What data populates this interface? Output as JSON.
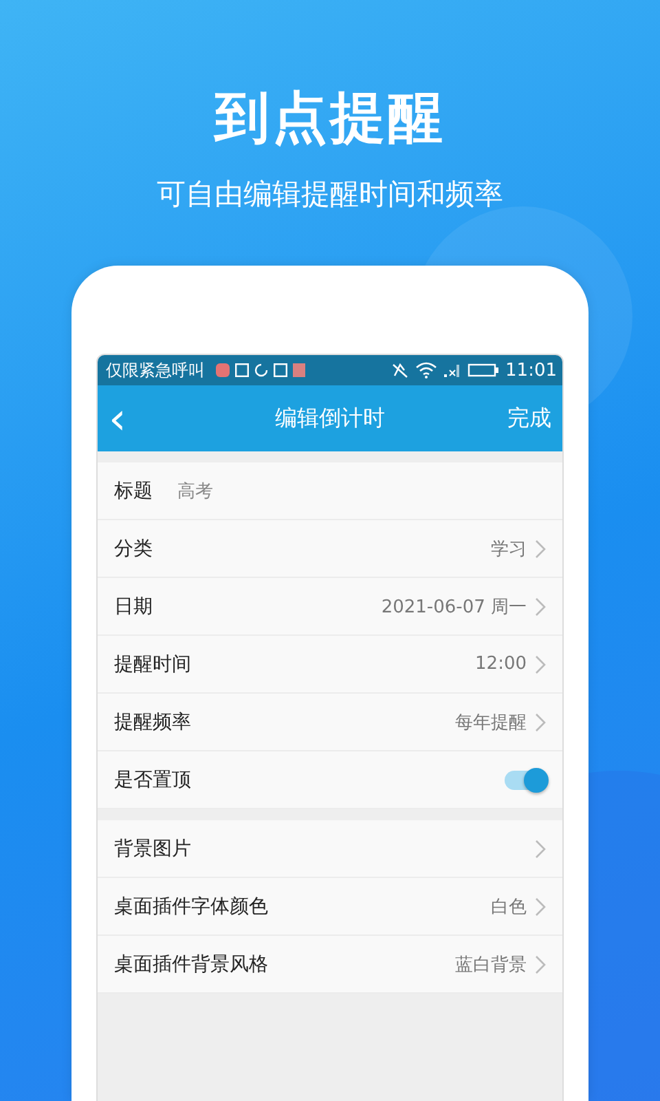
{
  "headline": "到点提醒",
  "subtitle": "可自由编辑提醒时间和频率",
  "status_bar": {
    "carrier": "仅限紧急呼叫",
    "time": "11:01"
  },
  "app_bar": {
    "back": "‹",
    "title": "编辑倒计时",
    "action": "完成"
  },
  "sections": [
    {
      "rows": [
        {
          "kind": "input",
          "label": "标题",
          "value": "高考"
        },
        {
          "kind": "select",
          "label": "分类",
          "value": "学习"
        },
        {
          "kind": "select",
          "label": "日期",
          "value": "2021-06-07  周一"
        },
        {
          "kind": "select",
          "label": "提醒时间",
          "value": "12:00"
        },
        {
          "kind": "select",
          "label": "提醒频率",
          "value": "每年提醒"
        },
        {
          "kind": "toggle",
          "label": "是否置顶",
          "on": true
        }
      ]
    },
    {
      "rows": [
        {
          "kind": "select",
          "label": "背景图片"
        },
        {
          "kind": "select",
          "label": "桌面插件字体颜色",
          "value": "白色"
        },
        {
          "kind": "select",
          "label": "桌面插件背景风格",
          "value": "蓝白背景"
        }
      ]
    }
  ]
}
